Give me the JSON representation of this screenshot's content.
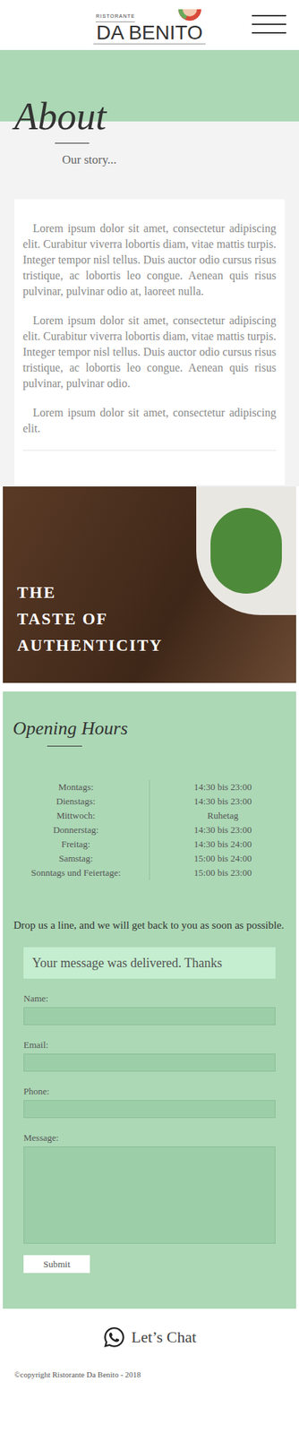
{
  "header": {
    "logo_small": "RISTORANTE",
    "logo_name": "DA BENITO"
  },
  "about": {
    "title": "About",
    "subtitle": "Our story...",
    "paragraphs": [
      "Lorem ipsum dolor sit amet, consectetur adipiscing elit. Curabitur viverra lobortis diam, vitae mattis turpis. Integer tempor nisl tellus. Duis auctor odio cursus risus tristique, ac lobortis leo congue. Aenean quis risus pulvinar, pulvinar odio at, laoreet nulla.",
      "Lorem ipsum dolor sit amet, consectetur adipiscing elit. Curabitur viverra lobortis diam, vitae mattis turpis. Integer tempor nisl tellus. Duis auctor odio cursus risus tristique, ac lobortis leo congue. Aenean quis risus pulvinar, pulvinar odio.",
      "Lorem ipsum dolor sit amet, consectetur adipiscing elit."
    ]
  },
  "banner": {
    "lines": [
      "THE",
      "TASTE OF",
      "AUTHENTICITY"
    ]
  },
  "hours": {
    "title": "Opening Hours",
    "rows": [
      {
        "day": "Montags:",
        "time": "14:30 bis 23:00"
      },
      {
        "day": "Dienstags:",
        "time": "14:30 bis 23:00"
      },
      {
        "day": "Mittwoch:",
        "time": "Ruhetag"
      },
      {
        "day": "Donnerstag:",
        "time": "14:30 bis 23:00"
      },
      {
        "day": "Freitag:",
        "time": "14:30 bis 24:00"
      },
      {
        "day": "Samstag:",
        "time": "15:00 bis 24:00"
      },
      {
        "day": "Sonntags und Feiertage:",
        "time": "15:00 bis 23:00"
      }
    ]
  },
  "contact": {
    "intro": "Drop us a line, and we will get back to you as soon as possible.",
    "success": "Your message was delivered. Thanks",
    "fields": [
      {
        "label": "Name:",
        "kind": "input"
      },
      {
        "label": "Email:",
        "kind": "input"
      },
      {
        "label": "Phone:",
        "kind": "input"
      },
      {
        "label": "Message:",
        "kind": "textarea"
      }
    ],
    "submit": "Submit"
  },
  "footer": {
    "chat": "Let’s Chat",
    "copyright": "©copyright Ristorante Da Benito - 2018"
  }
}
